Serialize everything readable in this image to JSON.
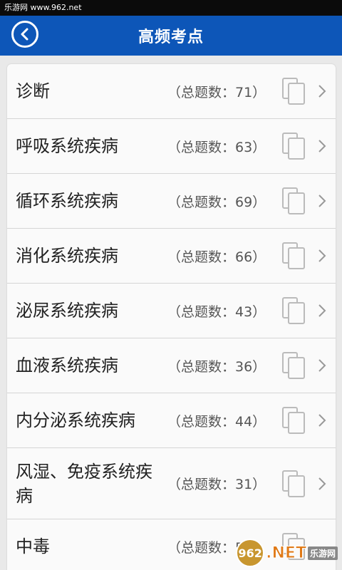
{
  "status_bar": {
    "text": "乐游网 www.962.net"
  },
  "header": {
    "title": "高频考点"
  },
  "count_label_prefix": "（总题数：",
  "count_label_suffix": "）",
  "items": [
    {
      "title": "诊断",
      "count_text": "（总题数：71）"
    },
    {
      "title": "呼吸系统疾病",
      "count_text": "（总题数：63）"
    },
    {
      "title": "循环系统疾病",
      "count_text": "（总题数：69）"
    },
    {
      "title": "消化系统疾病",
      "count_text": "（总题数：66）"
    },
    {
      "title": "泌尿系统疾病",
      "count_text": "（总题数：43）"
    },
    {
      "title": "血液系统疾病",
      "count_text": "（总题数：36）"
    },
    {
      "title": "内分泌系统疾病",
      "count_text": "（总题数：44）"
    },
    {
      "title": "风湿、免疫系统疾病",
      "count_text": "（总题数：31）"
    },
    {
      "title": "中毒",
      "count_text": "（总题数：5"
    }
  ],
  "watermark": {
    "logo": "962",
    "text": ".NET",
    "sub": "乐游网"
  },
  "colors": {
    "header_bg": "#0d56b8",
    "status_bg": "#0b0b0b",
    "page_bg": "#e9e9e9"
  }
}
